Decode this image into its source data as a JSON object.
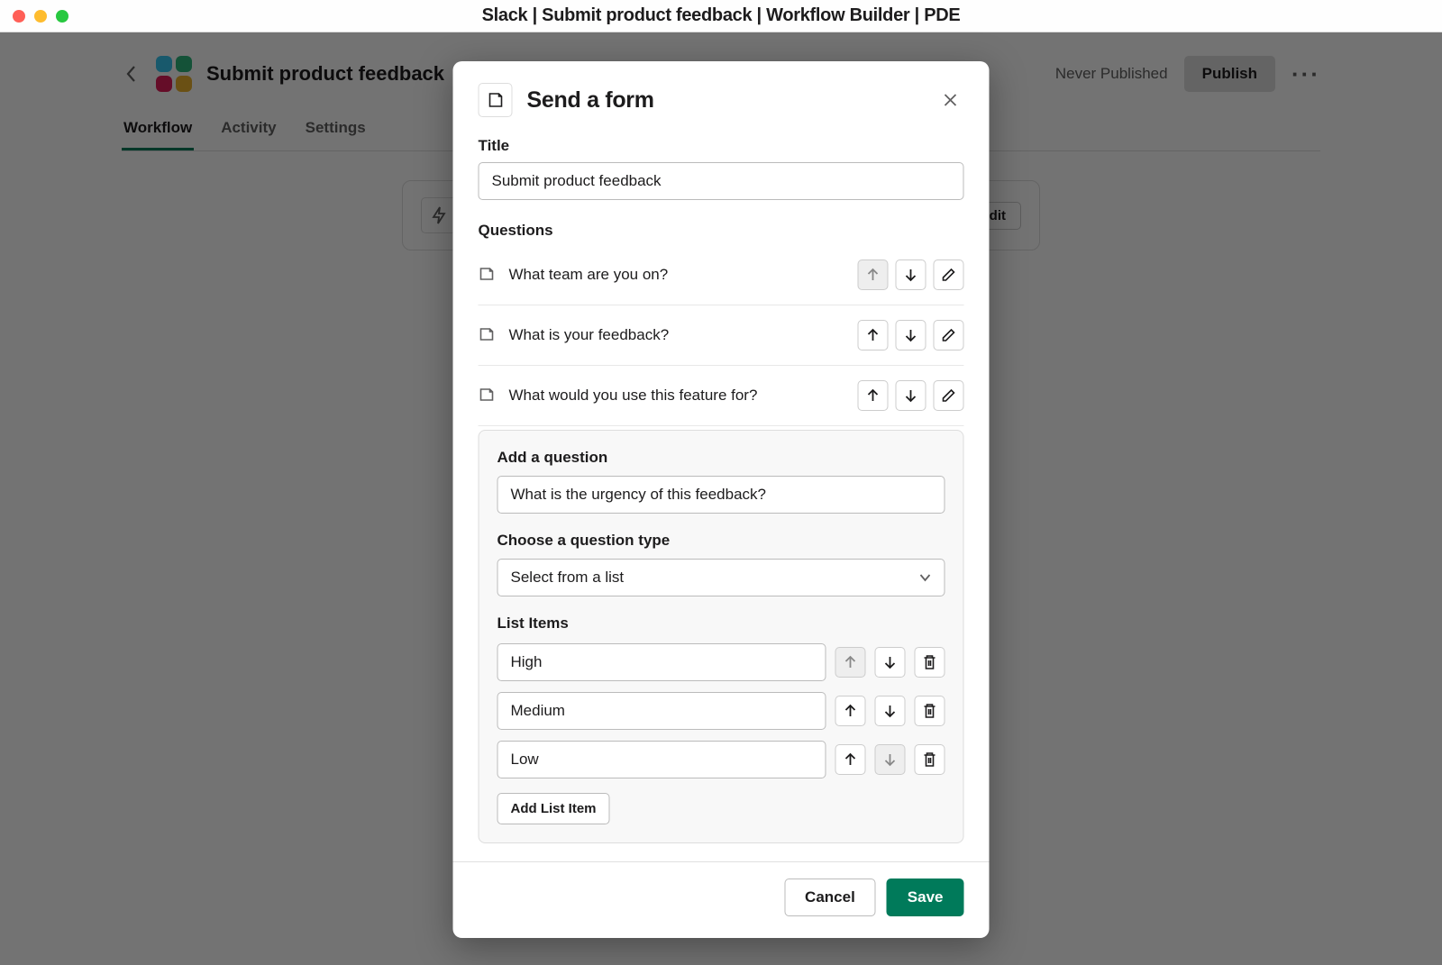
{
  "titlebar": {
    "title": "Slack | Submit product feedback | Workflow Builder | PDE"
  },
  "page": {
    "title": "Submit product feedback",
    "never_published": "Never Published",
    "publish": "Publish",
    "tabs": {
      "workflow": "Workflow",
      "activity": "Activity",
      "settings": "Settings"
    },
    "step_edit": "Edit"
  },
  "modal": {
    "title": "Send a form",
    "title_label": "Title",
    "title_value": "Submit product feedback",
    "questions_label": "Questions",
    "questions": [
      {
        "text": "What team are you on?"
      },
      {
        "text": "What is your feedback?"
      },
      {
        "text": "What would you use this feature for?"
      }
    ],
    "add_q": {
      "heading": "Add a question",
      "value": "What is the urgency of this feedback?",
      "type_label": "Choose a question type",
      "type_value": "Select from a list",
      "list_items_label": "List Items",
      "list_items": [
        {
          "value": "High"
        },
        {
          "value": "Medium"
        },
        {
          "value": "Low"
        }
      ],
      "add_list_item": "Add List Item"
    },
    "footer": {
      "cancel": "Cancel",
      "save": "Save"
    }
  }
}
